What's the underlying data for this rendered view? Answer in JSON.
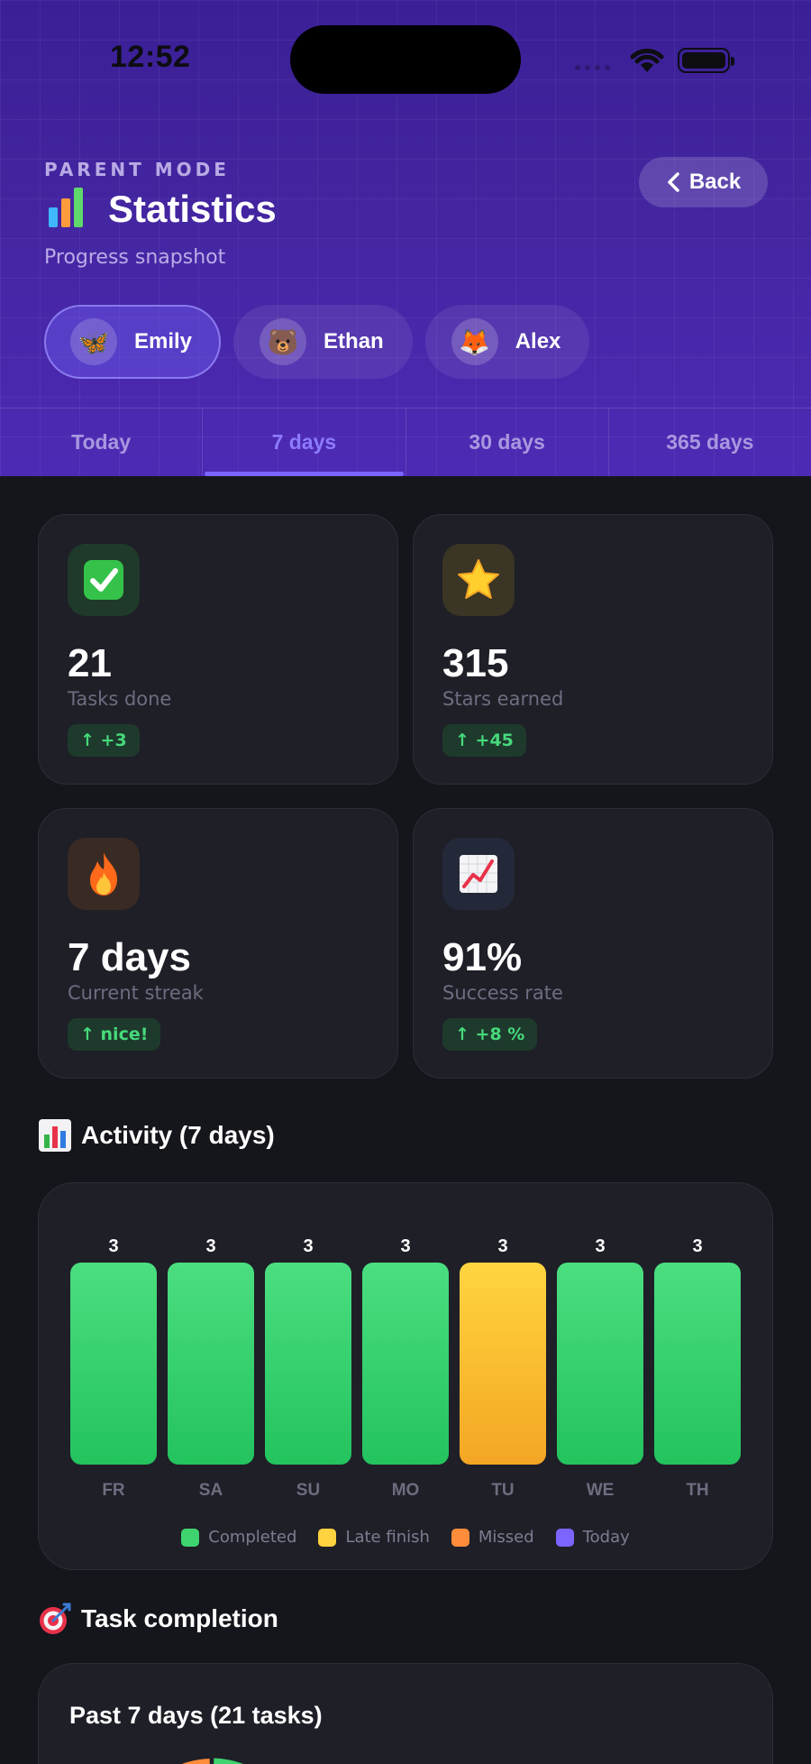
{
  "status_bar": {
    "time": "12:52"
  },
  "header": {
    "mode_label": "PARENT MODE",
    "title": "Statistics",
    "subtitle": "Progress snapshot",
    "back_label": "Back",
    "back_icon": "chevron-left-icon",
    "title_icon": "bar-chart-icon"
  },
  "children": [
    {
      "name": "Emily",
      "avatar": "🦋",
      "active": true
    },
    {
      "name": "Ethan",
      "avatar": "🐻",
      "active": false
    },
    {
      "name": "Alex",
      "avatar": "🦊",
      "active": false
    }
  ],
  "period_tabs": [
    {
      "label": "Today",
      "active": false
    },
    {
      "label": "7 days",
      "active": true
    },
    {
      "label": "30 days",
      "active": false
    },
    {
      "label": "365 days",
      "active": false
    }
  ],
  "stats": [
    {
      "icon": "checkmark-icon",
      "value": "21",
      "label": "Tasks done",
      "badge": "↑ +3"
    },
    {
      "icon": "star-icon",
      "value": "315",
      "label": "Stars earned",
      "badge": "↑ +45"
    },
    {
      "icon": "fire-icon",
      "value": "7 days",
      "label": "Current streak",
      "badge": "↑ nice!"
    },
    {
      "icon": "trend-chart-icon",
      "value": "91%",
      "label": "Success rate",
      "badge": "↑ +8 %"
    }
  ],
  "activity": {
    "title": "Activity (7 days)",
    "legend": [
      {
        "label": "Completed",
        "color": "#3ed36f"
      },
      {
        "label": "Late finish",
        "color": "#ffd23f"
      },
      {
        "label": "Missed",
        "color": "#ff8c3a"
      },
      {
        "label": "Today",
        "color": "#7a66ff"
      }
    ]
  },
  "chart_data": {
    "type": "bar",
    "categories": [
      "FR",
      "SA",
      "SU",
      "MO",
      "TU",
      "WE",
      "TH"
    ],
    "values": [
      3,
      3,
      3,
      3,
      3,
      3,
      3
    ],
    "status": [
      "completed",
      "completed",
      "completed",
      "completed",
      "late",
      "completed",
      "completed"
    ],
    "ylim": [
      0,
      3
    ],
    "legend": "bottom-center",
    "grid": false,
    "colors": {
      "completed": "#3ed36f",
      "late": "#ffd23f"
    }
  },
  "completion": {
    "section_title": "Task completion",
    "card_title": "Past 7 days (21 tasks)"
  },
  "theme": {
    "accent": "#7a66ff",
    "header_bg": "#3f229c",
    "card_bg": "#1e1f27",
    "positive": "#46d97b"
  }
}
